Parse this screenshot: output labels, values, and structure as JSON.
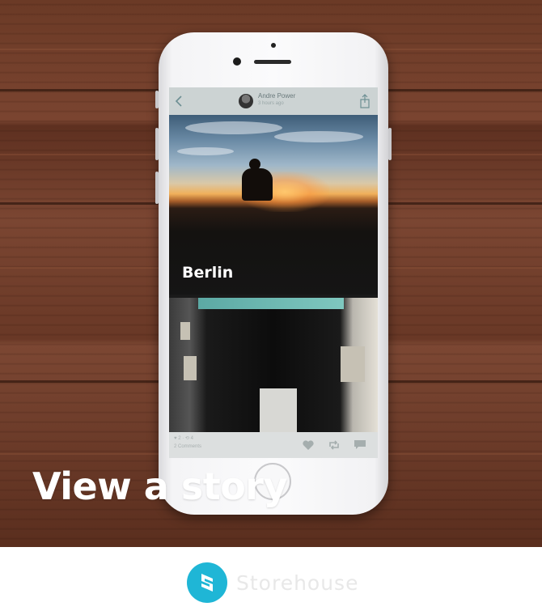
{
  "app": {
    "author_name": "Andre Power",
    "author_time": "3 hours ago",
    "story_title": "Berlin",
    "footer_stats": "♥ 2 · ⟲ 4",
    "footer_comments": "2 Comments"
  },
  "caption": "View a story",
  "brand": {
    "name": "Storehouse",
    "color": "#1fb6d6"
  },
  "icons": {
    "back": "chevron-left-icon",
    "share": "share-icon",
    "like": "heart-icon",
    "repost": "repost-icon",
    "comment": "comment-icon"
  }
}
